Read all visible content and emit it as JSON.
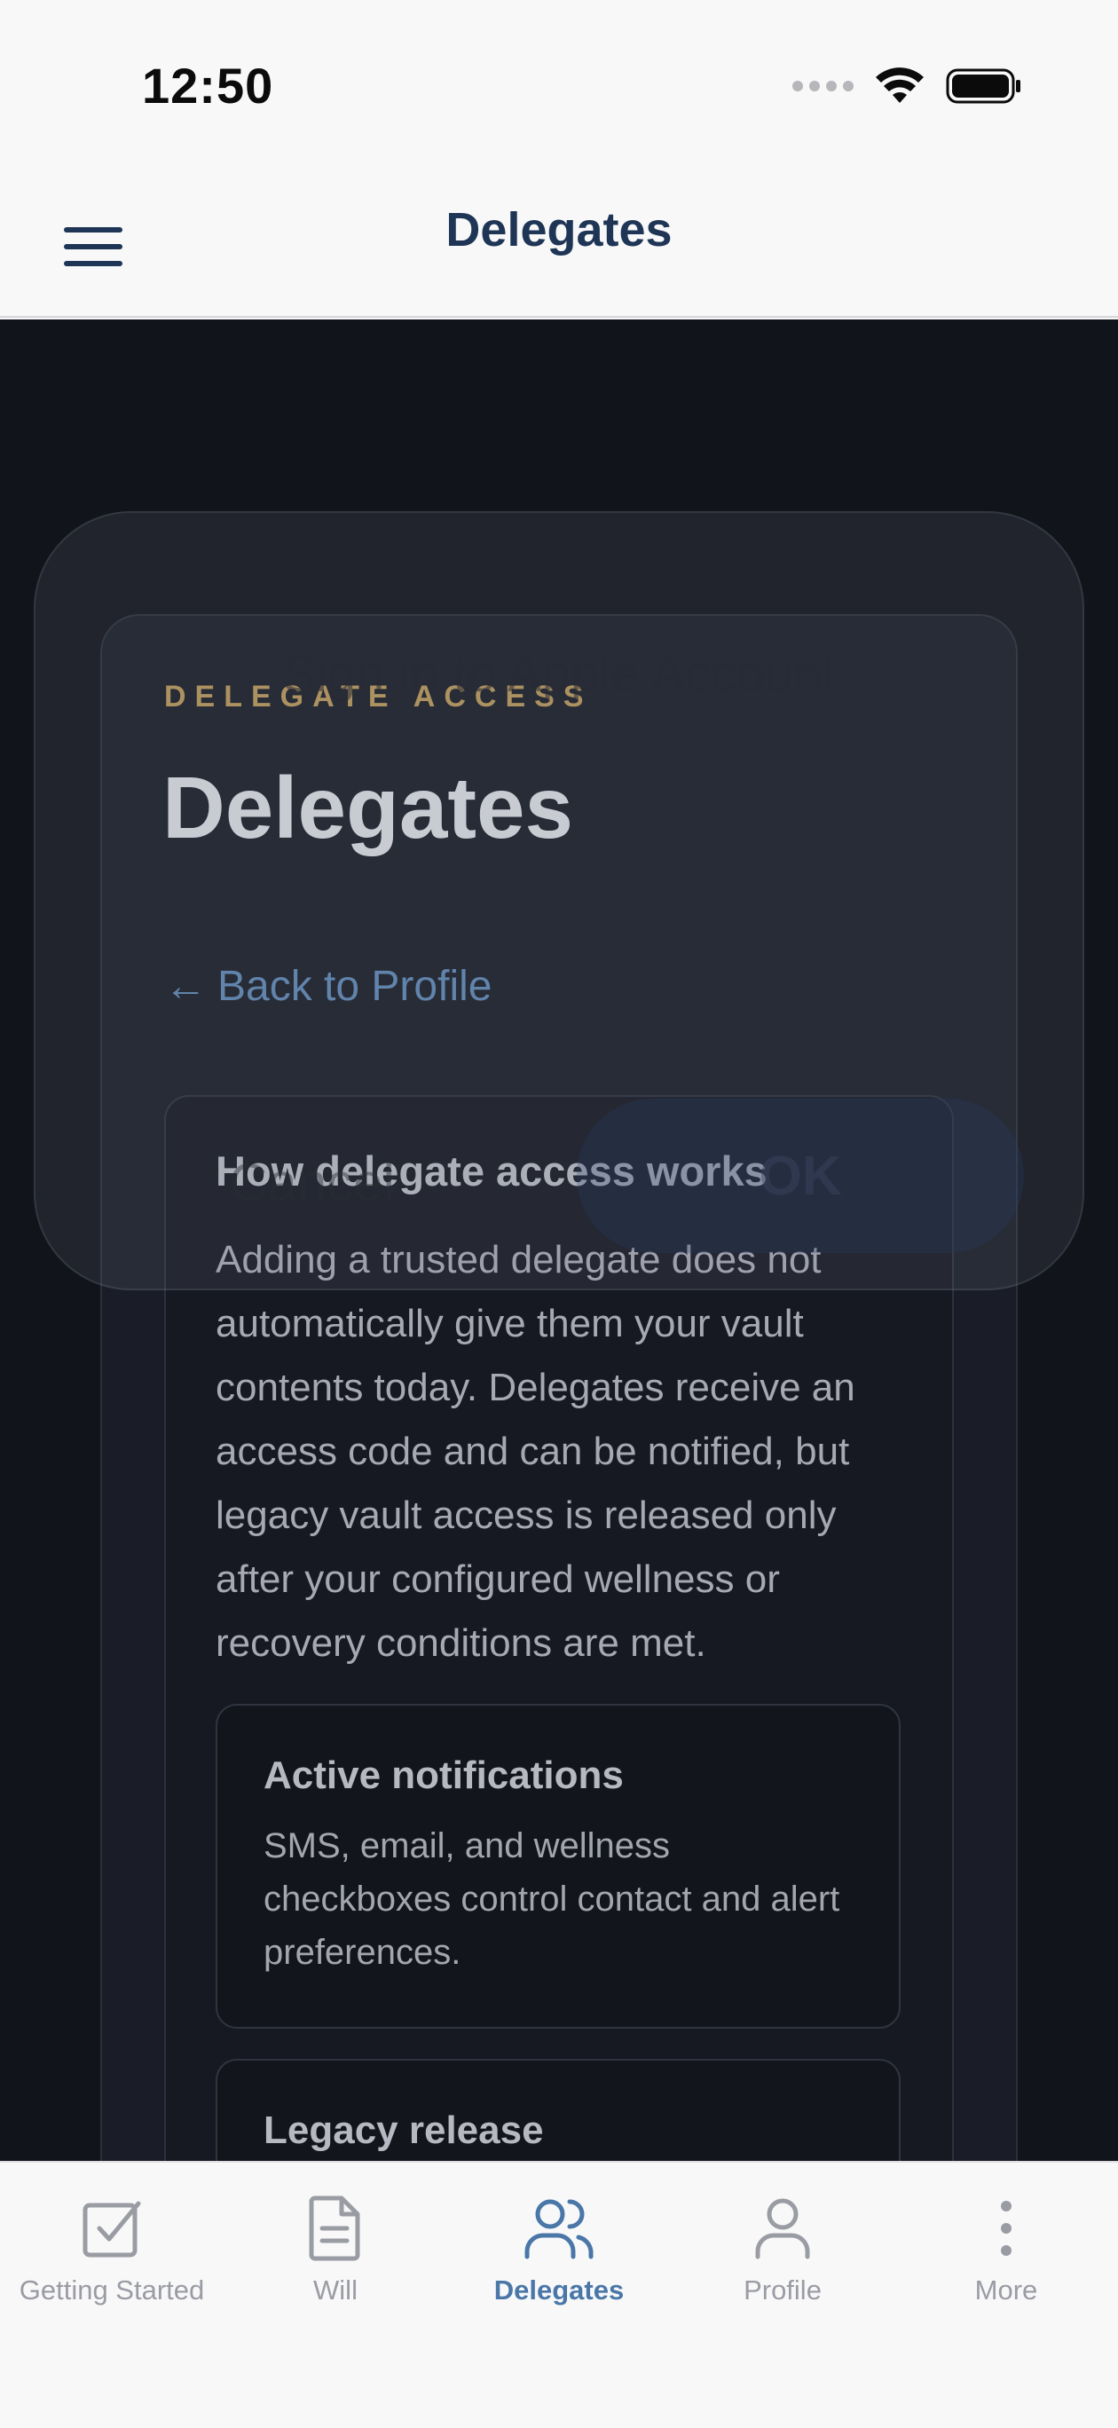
{
  "status_bar": {
    "time": "12:50"
  },
  "nav": {
    "title": "Delegates"
  },
  "card": {
    "eyebrow": "DELEGATE ACCESS",
    "title": "Delegates",
    "back_arrow": "←",
    "back_label": "Back to Profile",
    "info": {
      "heading": "How delegate access works",
      "body": "Adding a trusted delegate does not automatically give them your vault contents today. Delegates receive an access code and can be notified, but legacy vault access is released only after your configured wellness or recovery conditions are met."
    },
    "boxes": [
      {
        "title": "Active notifications",
        "body": "SMS, email, and wellness checkboxes control contact and alert preferences."
      },
      {
        "title": "Legacy release",
        "body": ""
      }
    ]
  },
  "dialog": {
    "title": "Sign in to Apple Account",
    "cancel": "Cancel",
    "ok": "OK"
  },
  "tabs": [
    {
      "label": "Getting Started",
      "icon": "checkbox-icon",
      "active": false
    },
    {
      "label": "Will",
      "icon": "document-icon",
      "active": false
    },
    {
      "label": "Delegates",
      "icon": "people-icon",
      "active": true
    },
    {
      "label": "Profile",
      "icon": "person-icon",
      "active": false
    },
    {
      "label": "More",
      "icon": "more-vertical-icon",
      "active": false
    }
  ],
  "colors": {
    "accent": "#4a77a8",
    "eyebrow": "#b7965a",
    "nav_title": "#1e3556",
    "background_dark": "#11141b"
  }
}
